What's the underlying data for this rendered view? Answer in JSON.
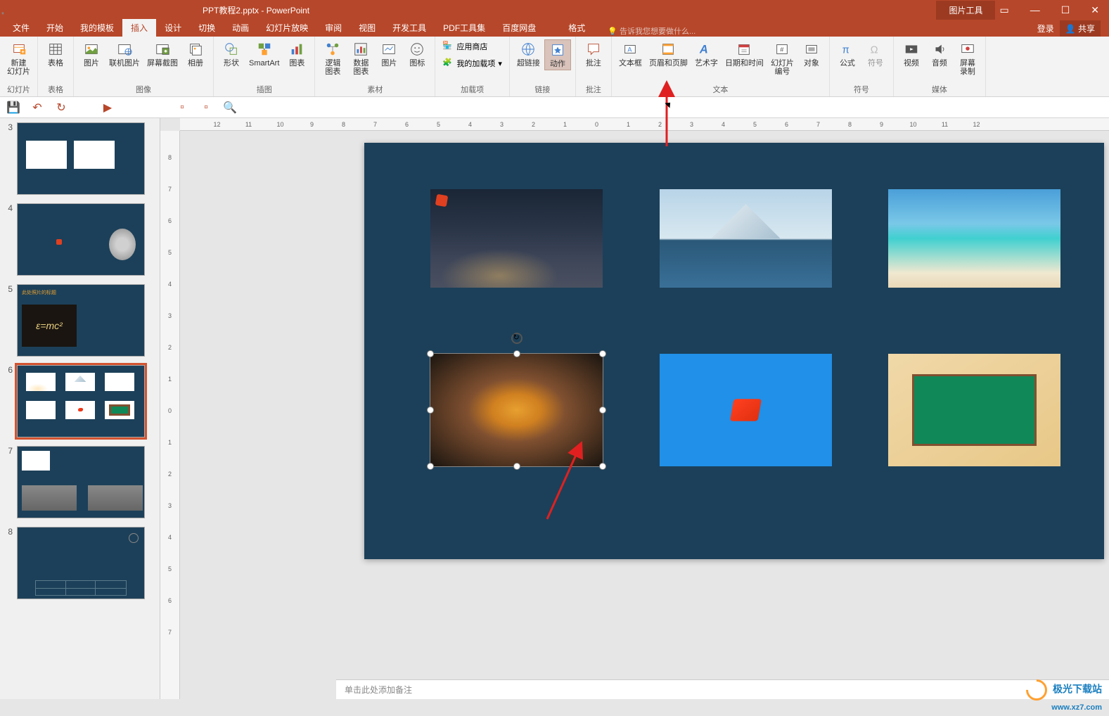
{
  "title": {
    "filename": "PPT教程2.pptx",
    "app": "PowerPoint",
    "toolTab": "图片工具"
  },
  "tabs": {
    "file": "文件",
    "home": "开始",
    "template": "我的模板",
    "insert": "插入",
    "design": "设计",
    "transition": "切换",
    "animation": "动画",
    "slideshow": "幻灯片放映",
    "review": "审阅",
    "view": "视图",
    "developer": "开发工具",
    "pdf": "PDF工具集",
    "baidu": "百度网盘",
    "format": "格式",
    "tellMe": "告诉我您想要做什么...",
    "login": "登录",
    "share": "共享"
  },
  "ribbon": {
    "newSlide": "新建\n幻灯片",
    "table": "表格",
    "picture": "图片",
    "onlinePicture": "联机图片",
    "screenshot": "屏幕截图",
    "album": "相册",
    "shapes": "形状",
    "smartart": "SmartArt",
    "chart": "图表",
    "logicChart": "逻辑\n图表",
    "dataChart": "数据\n图表",
    "stockPicture": "图片",
    "icon": "图标",
    "store": "应用商店",
    "myAddins": "我的加载项",
    "hyperlink": "超链接",
    "action": "动作",
    "comment": "批注",
    "textbox": "文本框",
    "headerFooter": "页眉和页脚",
    "wordart": "艺术字",
    "dateTime": "日期和时间",
    "slideNumber": "幻灯片\n编号",
    "object": "对象",
    "equation": "公式",
    "symbol": "符号",
    "video": "视频",
    "audio": "音频",
    "screenRecord": "屏幕\n录制",
    "groups": {
      "slides": "幻灯片",
      "tables": "表格",
      "images": "图像",
      "illustrations": "插图",
      "material": "素材",
      "addins": "加载项",
      "links": "链接",
      "comments": "批注",
      "text": "文本",
      "symbols": "符号",
      "media": "媒体"
    }
  },
  "slides": [
    {
      "num": "3",
      "star": "*"
    },
    {
      "num": "4"
    },
    {
      "num": "5",
      "headline": "此处照片的标题"
    },
    {
      "num": "6",
      "star": "*"
    },
    {
      "num": "7"
    },
    {
      "num": "8"
    }
  ],
  "rulerH": [
    "12",
    "11",
    "10",
    "9",
    "8",
    "7",
    "6",
    "5",
    "4",
    "3",
    "2",
    "1",
    "0",
    "1",
    "2",
    "3",
    "4",
    "5",
    "6",
    "7",
    "8",
    "9",
    "10",
    "11",
    "12"
  ],
  "rulerV": [
    "8",
    "7",
    "6",
    "5",
    "4",
    "3",
    "2",
    "1",
    "0",
    "1",
    "2",
    "3",
    "4",
    "5",
    "6",
    "7"
  ],
  "notes": "单击此处添加备注",
  "watermark": {
    "name": "极光下载站",
    "url": "www.xz7.com"
  }
}
